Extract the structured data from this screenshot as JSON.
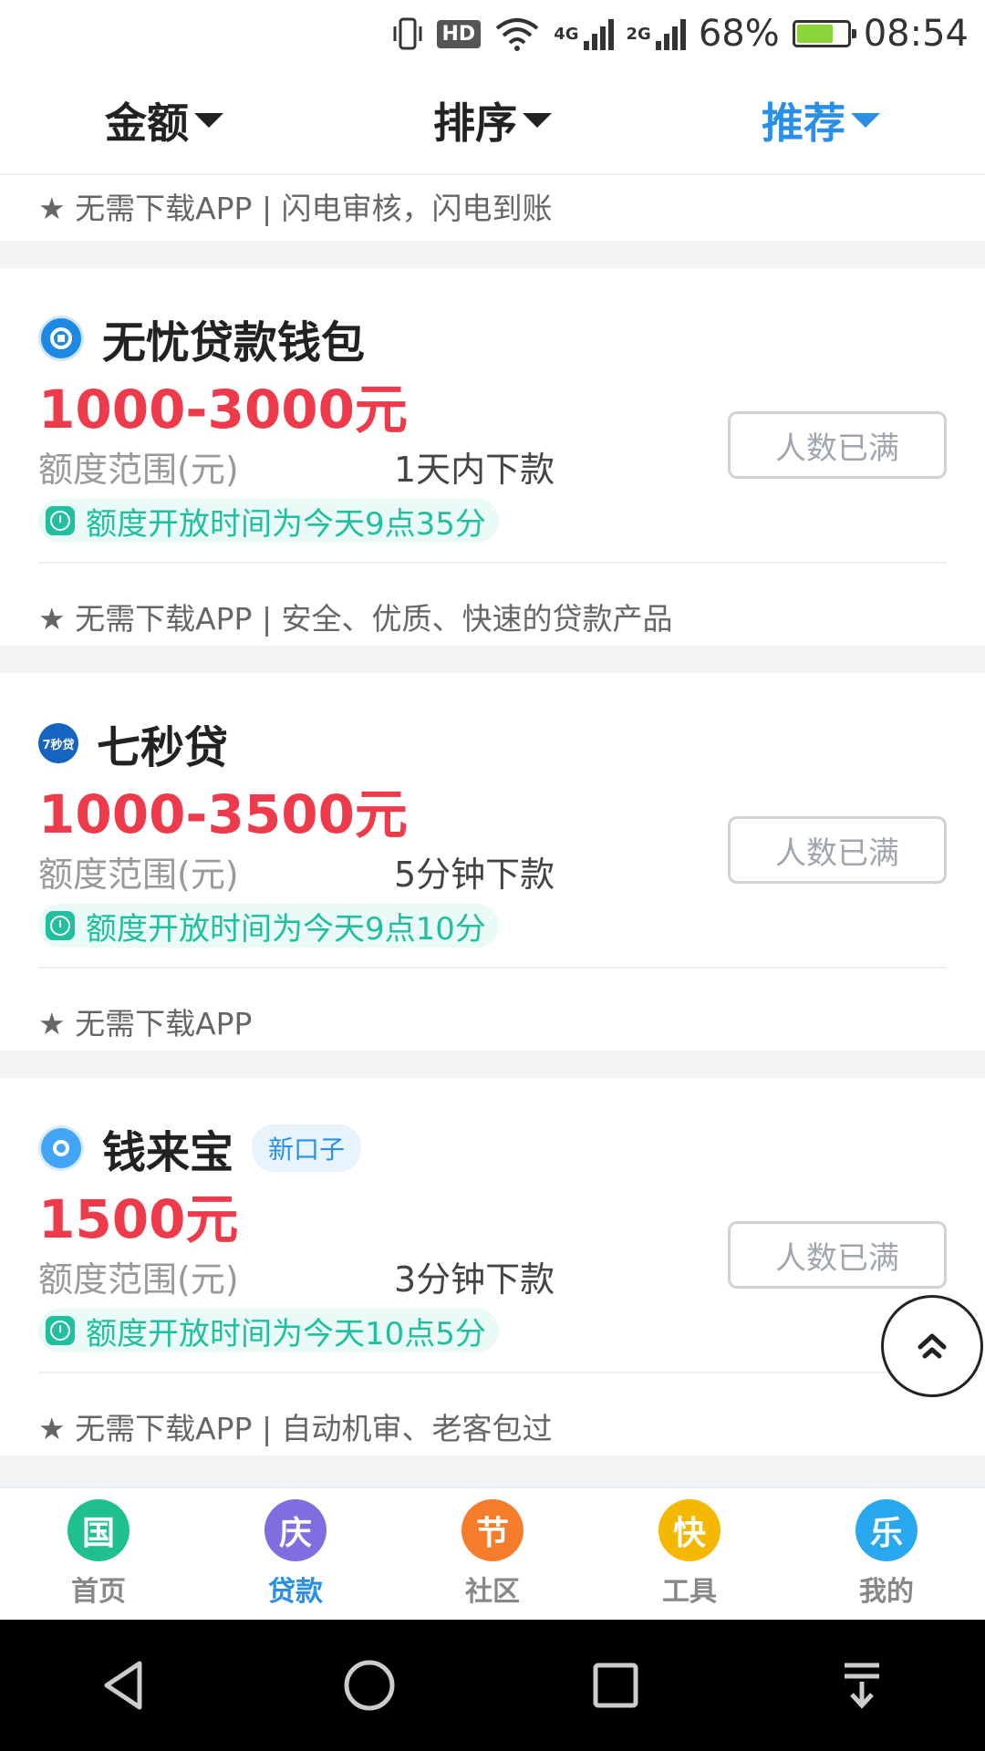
{
  "status_bar": {
    "net1": "4G",
    "net2": "2G",
    "hd": "HD",
    "battery": "68%",
    "time": "08:54"
  },
  "filters": [
    {
      "label": "金额",
      "active": false
    },
    {
      "label": "排序",
      "active": false
    },
    {
      "label": "推荐",
      "active": true
    }
  ],
  "partial_card": {
    "tagline": "★ 无需下载APP | 闪电审核，闪电到账"
  },
  "cards": [
    {
      "name": "无忧贷款钱包",
      "logo_icon": "wuyou-logo-icon",
      "logo_color": "#1e88e5",
      "amount": "1000-3000元",
      "range_label": "额度范围(元)",
      "speed": "1天内下款",
      "button": "人数已满",
      "open_time": "额度开放时间为今天9点35分",
      "tagline": "★ 无需下载APP | 安全、优质、快速的贷款产品"
    },
    {
      "name": "七秒贷",
      "logo_icon": "qimiaodai-logo-icon",
      "logo_color": "#1565c0",
      "logo_text": "7秒贷",
      "amount": "1000-3500元",
      "range_label": "额度范围(元)",
      "speed": "5分钟下款",
      "button": "人数已满",
      "open_time": "额度开放时间为今天9点10分",
      "tagline": "★ 无需下载APP"
    },
    {
      "name": "钱来宝",
      "tag": "新口子",
      "logo_icon": "qianlaibao-logo-icon",
      "logo_color": "#42a5f5",
      "amount": "1500元",
      "range_label": "额度范围(元)",
      "speed": "3分钟下款",
      "button": "人数已满",
      "open_time": "额度开放时间为今天10点5分",
      "tagline": "★ 无需下载APP | 自动机审、老客包过"
    }
  ],
  "bottom_nav": [
    {
      "glyph": "国",
      "label": "首页",
      "color": "#1fbf8f",
      "active": false
    },
    {
      "glyph": "庆",
      "label": "贷款",
      "color": "#7e6ee0",
      "active": true
    },
    {
      "glyph": "节",
      "label": "社区",
      "color": "#f57c2b",
      "active": false
    },
    {
      "glyph": "快",
      "label": "工具",
      "color": "#f5b800",
      "active": false
    },
    {
      "glyph": "乐",
      "label": "我的",
      "color": "#29a8f0",
      "active": false
    }
  ],
  "colors": {
    "accent": "#2a8fe6",
    "amount_red": "#ee3b4c",
    "teal": "#1fbfa0"
  }
}
